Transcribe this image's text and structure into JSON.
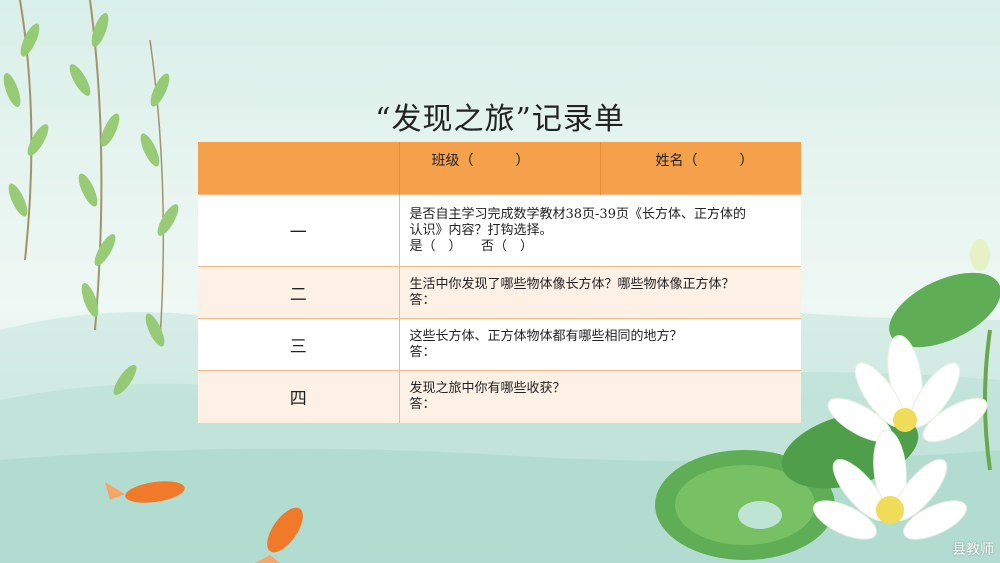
{
  "title": "“发现之旅”记录单",
  "header": {
    "col1": "",
    "class_label": "班级（　　　）",
    "name_label": "姓名（　　　）"
  },
  "rows": [
    {
      "num": "一",
      "lines": [
        "是否自主学习完成数学教材38页-39页《长方体、正方体的",
        "认识》内容？打钩选择。",
        "是（　）　　否（　）"
      ]
    },
    {
      "num": "二",
      "lines": [
        "生活中你发现了哪些物体像长方体？哪些物体像正方体？",
        "答："
      ]
    },
    {
      "num": "三",
      "lines": [
        "这些长方体、正方体物体都有哪些相同的地方？",
        "答："
      ]
    },
    {
      "num": "四",
      "lines": [
        "发现之旅中你有哪些收获？",
        "答："
      ]
    }
  ],
  "watermark": "县教师",
  "colors": {
    "header_orange": "#f5a04a",
    "row_cream": "#fdf1e6",
    "leaf_green": "#8cc66a",
    "lotus_white": "#ffffff",
    "koi_orange": "#f07a2a"
  }
}
